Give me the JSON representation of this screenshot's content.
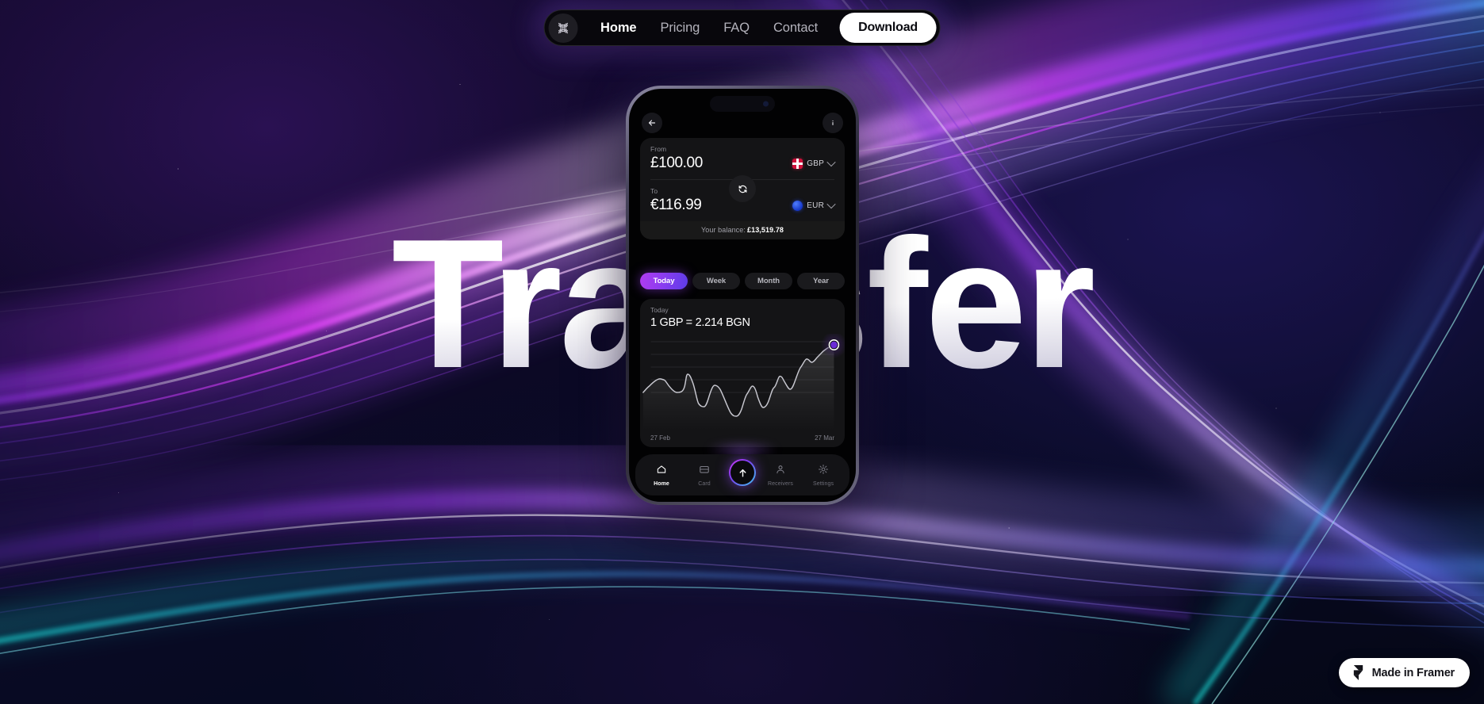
{
  "brand": {
    "logo_icon": "x-braid-logo-icon",
    "accent_purple": "#8b3cf0",
    "accent_magenta": "#b03cf0",
    "accent_cyan": "#3cc8f0"
  },
  "navbar": {
    "links": [
      {
        "label": "Home",
        "active": true
      },
      {
        "label": "Pricing",
        "active": false
      },
      {
        "label": "FAQ",
        "active": false
      },
      {
        "label": "Contact",
        "active": false
      }
    ],
    "cta_label": "Download"
  },
  "hero": {
    "headline": "Transfer"
  },
  "phone": {
    "header": {
      "back_icon": "arrow-left-icon",
      "info_icon": "info-icon"
    },
    "converter": {
      "from_label": "From",
      "from_amount": "£100.00",
      "from_currency": "GBP",
      "from_flag_icon": "flag-gbp-icon",
      "to_label": "To",
      "to_amount": "€116.99",
      "to_currency": "EUR",
      "to_flag_icon": "flag-eur-icon",
      "swap_icon": "swap-refresh-icon",
      "balance_label": "Your balance:",
      "balance_value": "£13,519.78"
    },
    "period_tabs": [
      {
        "label": "Today",
        "active": true
      },
      {
        "label": "Week",
        "active": false
      },
      {
        "label": "Month",
        "active": false
      },
      {
        "label": "Year",
        "active": false
      }
    ],
    "chart_card": {
      "period": "Today",
      "rate": "1 GBP = 2.214 BGN",
      "start_date": "27 Feb",
      "end_date": "27 Mar"
    },
    "bottom_nav": [
      {
        "label": "Home",
        "icon": "home-icon",
        "active": true
      },
      {
        "label": "Card",
        "icon": "card-icon",
        "active": false
      },
      {
        "label": "Receivers",
        "icon": "person-icon",
        "active": false
      },
      {
        "label": "Settings",
        "icon": "gear-icon",
        "active": false
      }
    ],
    "send_button": {
      "icon": "arrow-up-icon",
      "label": "Send"
    }
  },
  "chart_data": {
    "type": "line",
    "title": "1 GBP = 2.214 BGN",
    "subtitle": "Today",
    "xlabel": "",
    "ylabel": "",
    "x": [
      "27 Feb",
      "27 Mar"
    ],
    "grid": true,
    "legend": false,
    "values": [
      2.15,
      2.162,
      2.172,
      2.176,
      2.17,
      2.158,
      2.15,
      2.154,
      2.186,
      2.168,
      2.13,
      2.124,
      2.146,
      2.166,
      2.158,
      2.138,
      2.112,
      2.106,
      2.12,
      2.148,
      2.164,
      2.142,
      2.122,
      2.134,
      2.16,
      2.182,
      2.172,
      2.158,
      2.176,
      2.2,
      2.214
    ],
    "ylim": [
      2.09,
      2.23
    ],
    "marker": {
      "x": "27 Mar",
      "y": 2.214,
      "color": "#6b2bd6"
    }
  },
  "framer_badge": {
    "label": "Made in Framer",
    "icon": "framer-logo-icon"
  }
}
